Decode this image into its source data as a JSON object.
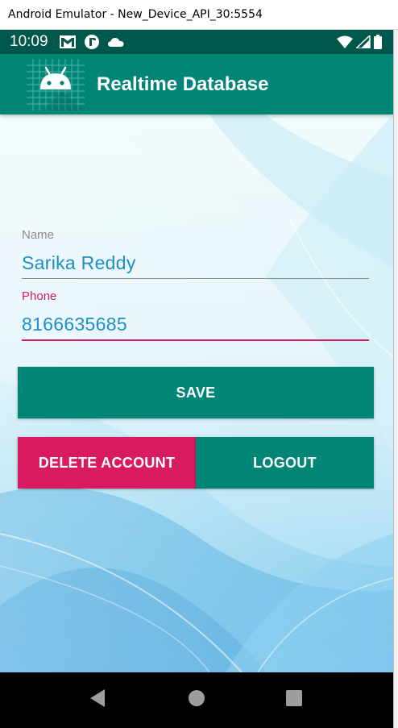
{
  "window": {
    "title": "Android Emulator - New_Device_API_30:5554"
  },
  "status_bar": {
    "time": "10:09",
    "left_icons": [
      "gmail-icon",
      "app-notification-icon",
      "cloud-icon"
    ],
    "right_icons": [
      "wifi-icon",
      "signal-icon",
      "battery-icon"
    ]
  },
  "app_bar": {
    "title": "Realtime Database"
  },
  "form": {
    "name_label": "Name",
    "name_value": "Sarika Reddy",
    "phone_label": "Phone",
    "phone_value": "8166635685"
  },
  "buttons": {
    "save": "SAVE",
    "delete_account": "DELETE ACCOUNT",
    "logout": "LOGOUT"
  },
  "colors": {
    "primary": "#008577",
    "primary_dark": "#00574b",
    "accent": "#d81b60",
    "text_value": "#1e8fc6"
  },
  "nav_bar": {
    "buttons": [
      "back-icon",
      "home-icon",
      "recents-icon"
    ]
  }
}
